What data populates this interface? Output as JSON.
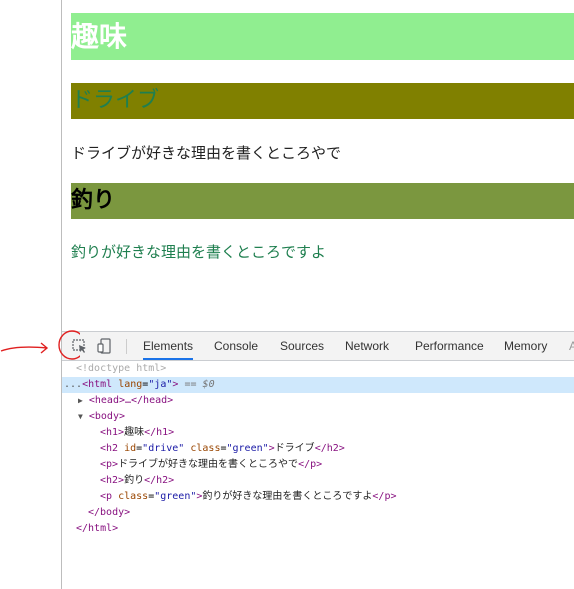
{
  "page": {
    "h1": "趣味",
    "h2_drive": "ドライブ",
    "p_drive": "ドライブが好きな理由を書くところやで",
    "h2_fishing": "釣り",
    "p_fishing": "釣りが好きな理由を書くところですよ"
  },
  "devtools": {
    "tabs": [
      "Elements",
      "Console",
      "Sources",
      "Network",
      "Performance",
      "Memory"
    ],
    "active_tab": "Elements",
    "overflow_tab_fragment": "A",
    "tree": {
      "doctype": "<!doctype html>",
      "html_open_dots": "...",
      "html_tag": "<html",
      "lang_attr": "lang",
      "lang_val": "\"ja\"",
      "html_close_bracket": ">",
      "selected_marker": "== $0",
      "head_line": "<head>…</head>",
      "body_open": "<body>",
      "h1_open": "<h1>",
      "h1_text": "趣味",
      "h1_close": "</h1>",
      "h2_open": "<h2",
      "id_attr": "id",
      "id_val": "\"drive\"",
      "class_attr": "class",
      "class_val": "\"green\"",
      "h2_open_end": ">",
      "h2_text": "ドライブ",
      "h2_close": "</h2>",
      "p_open": "<p>",
      "p_text": "ドライブが好きな理由を書くところやで",
      "p_close": "</p>",
      "h2b_open": "<h2>",
      "h2b_text": "釣り",
      "h2b_close": "</h2>",
      "p2_open": "<p",
      "p2_class_attr": "class",
      "p2_class_val": "\"green\"",
      "p2_open_end": ">",
      "p2_text": "釣りが好きな理由を書くところですよ",
      "p2_close": "</p>",
      "body_close": "</body>",
      "html_close": "</html>"
    }
  },
  "colors": {
    "h1_bg": "#90ee90",
    "h2_drive_bg": "#808000",
    "h2_fishing_bg": "#7b973f",
    "green_text": "#1f7f4f",
    "active_tab_underline": "#1a73e8",
    "annotation": "#e02020"
  },
  "icons": [
    "inspect-element-icon",
    "device-toolbar-icon"
  ]
}
